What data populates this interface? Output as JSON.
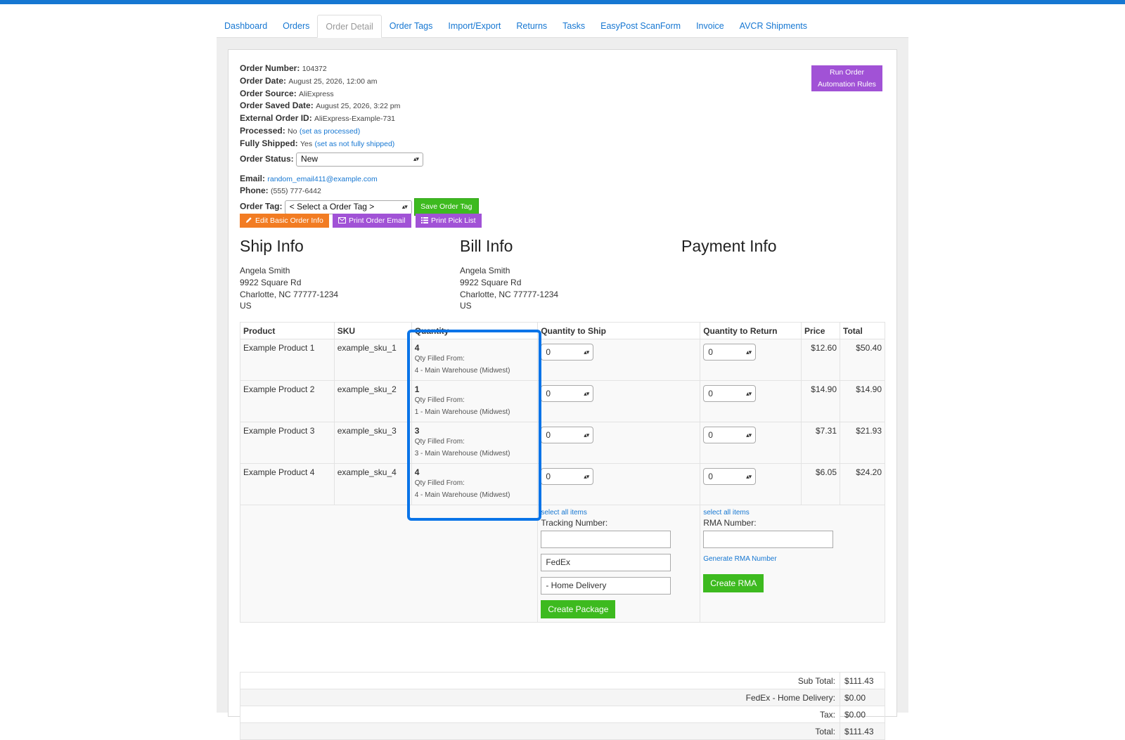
{
  "tabs": [
    "Dashboard",
    "Orders",
    "Order Detail",
    "Order Tags",
    "Import/Export",
    "Returns",
    "Tasks",
    "EasyPost ScanForm",
    "Invoice",
    "AVCR Shipments"
  ],
  "order": {
    "number_label": "Order Number:",
    "number": "104372",
    "date_label": "Order Date:",
    "date": "August 25, 2026, 12:00 am",
    "source_label": "Order Source:",
    "source": "AliExpress",
    "saved_label": "Order Saved Date:",
    "saved": "August 25, 2026, 3:22 pm",
    "external_label": "External Order ID:",
    "external": "AliExpress-Example-731",
    "processed_label": "Processed:",
    "processed": "No",
    "processed_link": "(set as processed)",
    "shipped_label": "Fully Shipped:",
    "shipped": "Yes",
    "shipped_link": "(set as not fully shipped)",
    "status_label": "Order Status:",
    "status": "New",
    "email_label": "Email:",
    "email": "random_email411@example.com",
    "phone_label": "Phone:",
    "phone": "(555) 777-6442",
    "tag_label": "Order Tag:",
    "tag_placeholder": "< Select a Order Tag >",
    "save_tag": "Save Order Tag"
  },
  "run_rules": "Run Order Automation Rules",
  "actions": {
    "edit": "Edit Basic Order Info",
    "print_email": "Print Order Email",
    "pick_list": "Print Pick List"
  },
  "sections": {
    "ship": "Ship Info",
    "bill": "Bill Info",
    "payment": "Payment Info"
  },
  "ship_address": {
    "name": "Angela Smith",
    "street": "9922 Square Rd",
    "city": "Charlotte, NC 77777-1234",
    "country": "US"
  },
  "bill_address": {
    "name": "Angela Smith",
    "street": "9922 Square Rd",
    "city": "Charlotte, NC 77777-1234",
    "country": "US"
  },
  "table": {
    "headers": [
      "Product",
      "SKU",
      "Quantity",
      "Quantity to Ship",
      "Quantity to Return",
      "Price",
      "Total"
    ],
    "filled_from_label": "Qty Filled From:",
    "rows": [
      {
        "product": "Example Product 1",
        "sku": "example_sku_1",
        "qty": "4",
        "filled": "4 - Main Warehouse (Midwest)",
        "ship": "0",
        "ret": "0",
        "price": "$12.60",
        "total": "$50.40"
      },
      {
        "product": "Example Product 2",
        "sku": "example_sku_2",
        "qty": "1",
        "filled": "1 - Main Warehouse (Midwest)",
        "ship": "0",
        "ret": "0",
        "price": "$14.90",
        "total": "$14.90"
      },
      {
        "product": "Example Product 3",
        "sku": "example_sku_3",
        "qty": "3",
        "filled": "3 - Main Warehouse (Midwest)",
        "ship": "0",
        "ret": "0",
        "price": "$7.31",
        "total": "$21.93"
      },
      {
        "product": "Example Product 4",
        "sku": "example_sku_4",
        "qty": "4",
        "filled": "4 - Main Warehouse (Midwest)",
        "ship": "0",
        "ret": "0",
        "price": "$6.05",
        "total": "$24.20"
      }
    ]
  },
  "ship_panel": {
    "select_all": "select all items",
    "tracking_label": "Tracking Number:",
    "tracking_value": "",
    "carrier": "FedEx",
    "service": "- Home Delivery",
    "create": "Create Package"
  },
  "return_panel": {
    "select_all": "select all items",
    "rma_label": "RMA Number:",
    "rma_value": "",
    "generate": "Generate RMA Number",
    "create": "Create RMA"
  },
  "totals": [
    {
      "label": "Sub Total:",
      "value": "$111.43"
    },
    {
      "label": "FedEx - Home Delivery:",
      "value": "$0.00"
    },
    {
      "label": "Tax:",
      "value": "$0.00"
    },
    {
      "label": "Total:",
      "value": "$111.43"
    }
  ]
}
